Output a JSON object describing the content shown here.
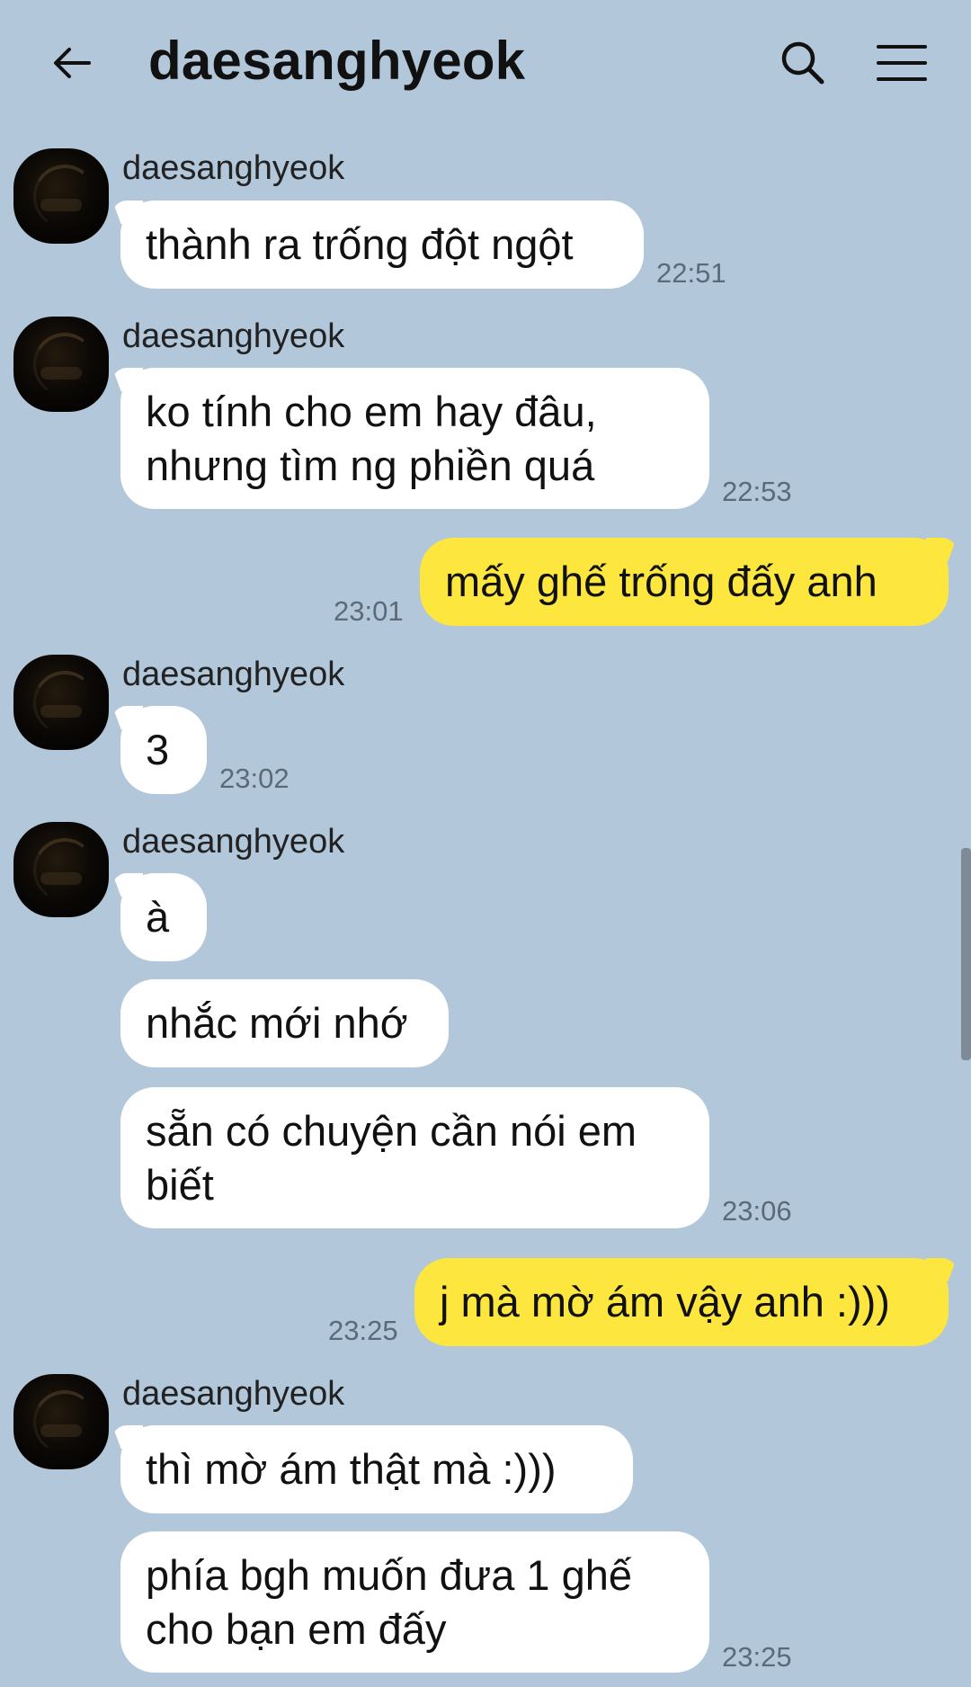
{
  "header": {
    "title": "daesanghyeok",
    "back_icon": "arrow-left-icon",
    "search_icon": "search-icon",
    "menu_icon": "hamburger-menu-icon"
  },
  "colors": {
    "background": "#b2c7da",
    "incoming_bubble": "#ffffff",
    "outgoing_bubble": "#fde73e",
    "time_text": "#5c6a78"
  },
  "messages": [
    {
      "direction": "in",
      "sender": "daesanghyeok",
      "text": "thành ra trống đột ngột",
      "time": "22:51"
    },
    {
      "direction": "in",
      "sender": "daesanghyeok",
      "text": "ko tính cho em hay đâu,\nnhưng tìm ng phiền quá",
      "time": "22:53"
    },
    {
      "direction": "out",
      "text": "mấy ghế trống đấy anh",
      "time": "23:01"
    },
    {
      "direction": "in",
      "sender": "daesanghyeok",
      "text": "3",
      "time": "23:02"
    },
    {
      "direction": "in",
      "sender": "daesanghyeok",
      "text": "à"
    },
    {
      "direction": "in",
      "text": "nhắc mới nhớ"
    },
    {
      "direction": "in",
      "text": "sẵn có chuyện cần nói em\nbiết",
      "time": "23:06"
    },
    {
      "direction": "out",
      "text": "j mà mờ ám vậy anh :)))",
      "time": "23:25"
    },
    {
      "direction": "in",
      "sender": "daesanghyeok",
      "text": "thì mờ ám thật mà :)))"
    },
    {
      "direction": "in",
      "text": "phía bgh muốn đưa 1 ghế\ncho bạn em đấy",
      "time": "23:25"
    }
  ]
}
